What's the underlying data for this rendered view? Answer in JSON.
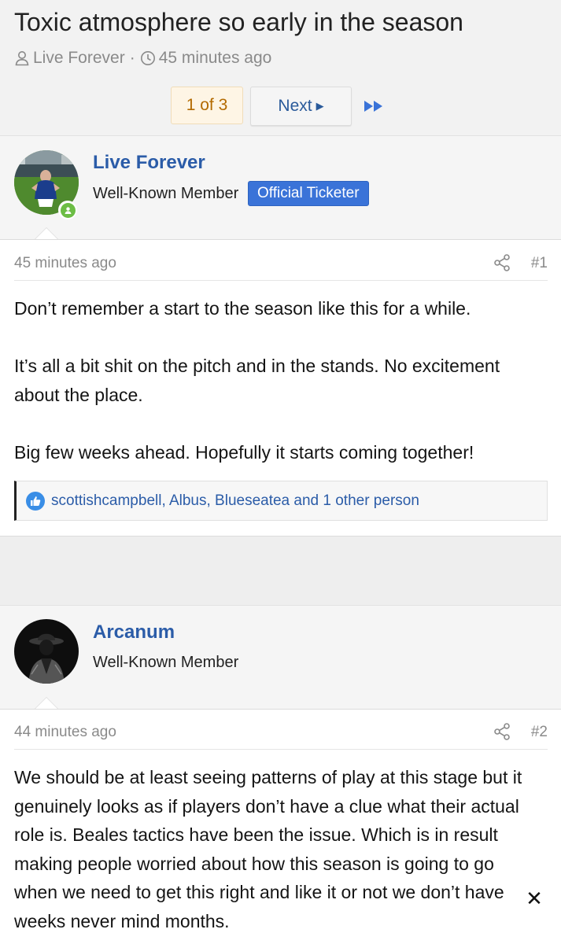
{
  "thread": {
    "title": "Toxic atmosphere so early in the season",
    "author": "Live Forever",
    "separator": "·",
    "time": "45 minutes ago"
  },
  "pagination": {
    "current": "1 of 3",
    "next_label": "Next"
  },
  "posts": [
    {
      "username": "Live Forever",
      "user_title": "Well-Known Member",
      "badge": "Official Ticketer",
      "time": "45 minutes ago",
      "number": "#1",
      "paragraphs": [
        "Don’t remember a start to the season like this for a while.",
        "It’s all a bit shit on the pitch and in the stands. No excitement about the place.",
        "Big few weeks ahead. Hopefully it starts coming together!"
      ],
      "reactions": "scottishcampbell, Albus, Blueseatea and 1 other person"
    },
    {
      "username": "Arcanum",
      "user_title": "Well-Known Member",
      "time": "44 minutes ago",
      "number": "#2",
      "paragraphs": [
        "We should be at least seeing patterns of play at this stage but it genuinely looks as if players don’t have a clue what their actual role is. Beales tactics have been the issue. Which is in result making people worried about how this season is going to go when we need to get this right and like it or not we don’t have weeks never mind months."
      ]
    }
  ],
  "icons": {
    "author": "user-icon",
    "clock": "clock-icon",
    "next": "caret-right-icon",
    "last": "fast-forward-icon",
    "share": "share-icon",
    "like": "like-icon",
    "online": "online-status-icon",
    "close": "close-icon"
  },
  "colors": {
    "link": "#2b5ca8",
    "badge": "#3a73d8",
    "online": "#6cbd45",
    "current_page_bg": "#fef5e5",
    "current_page_text": "#b36a00"
  }
}
